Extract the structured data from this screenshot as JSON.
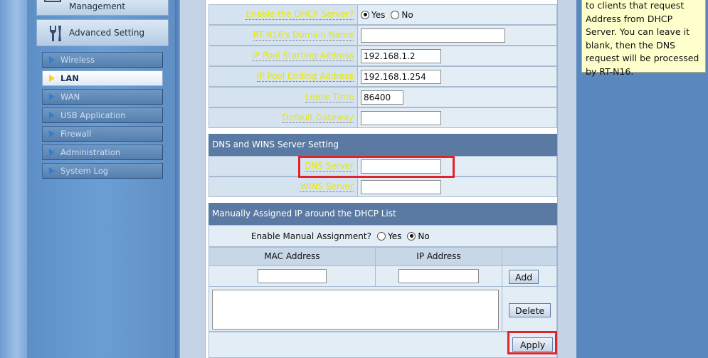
{
  "sidebar": {
    "management_label": "Management",
    "advanced_label": "Advanced Setting",
    "items": [
      {
        "label": "Wireless"
      },
      {
        "label": "LAN"
      },
      {
        "label": "WAN"
      },
      {
        "label": "USB Application"
      },
      {
        "label": "Firewall"
      },
      {
        "label": "Administration"
      },
      {
        "label": "System Log"
      }
    ]
  },
  "dhcp": {
    "enable_label": "Enable the DHCP Server?",
    "yes": "Yes",
    "no": "No",
    "domain_label": "RT-N16's Domain Name",
    "domain_value": "",
    "start_label": "IP Pool Starting Address",
    "start_value": "192.168.1.2",
    "end_label": "IP Pool Ending Address",
    "end_value": "192.168.1.254",
    "lease_label": "Lease Time",
    "lease_value": "86400",
    "gateway_label": "Default Gateway",
    "gateway_value": ""
  },
  "dns": {
    "section_title": "DNS and WINS Server Setting",
    "dns_label": "DNS Server",
    "dns_value": "",
    "wins_label": "WINS Server",
    "wins_value": ""
  },
  "manual": {
    "section_title": "Manually Assigned IP around the DHCP List",
    "enable_label": "Enable Manual Assignment?",
    "yes": "Yes",
    "no": "No",
    "col_mac": "MAC Address",
    "col_ip": "IP Address",
    "add_label": "Add",
    "delete_label": "Delete",
    "apply_label": "Apply"
  },
  "help": {
    "text_1": "to clients that request",
    "text_2": "Address from DHCP",
    "text_3": "Server. You can leave it",
    "text_4": "blank, then the DNS",
    "text_5": "request will be processed",
    "text_6": "by RT-N16."
  }
}
